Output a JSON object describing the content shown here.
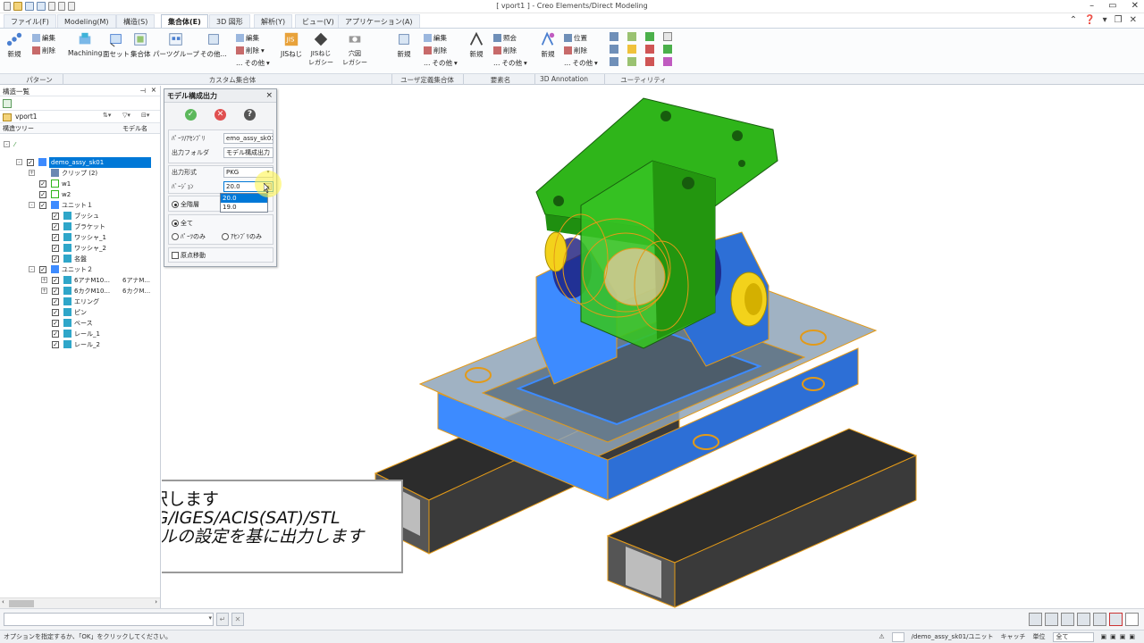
{
  "window": {
    "title": "[ vport1 ] - Creo Elements/Direct Modeling"
  },
  "tabs": [
    {
      "label": "ファイル(F)",
      "active": false
    },
    {
      "label": "Modeling(M)",
      "active": false
    },
    {
      "label": "構造(S)",
      "active": false
    },
    {
      "label": "集合体(E)",
      "active": true
    },
    {
      "label": "3D 図形",
      "active": false
    },
    {
      "label": "解析(Y)",
      "active": false
    },
    {
      "label": "ビュー(V)",
      "active": false
    },
    {
      "label": "アプリケーション(A)",
      "active": false
    }
  ],
  "ribbon": {
    "pattern": {
      "new": "新規",
      "edit": "編集",
      "delete": "削除"
    },
    "custom": {
      "machining": "Machining",
      "faceset": "面セット",
      "assembly_set": "集合体",
      "parts_group": "パーツグループ",
      "other": "その他...",
      "edit": "編集",
      "delete": "削除",
      "other_small": "その他",
      "jis_screw": "JISねじ",
      "jis_screw_legacy": "JISねじ\nレガシー",
      "hole_legacy": "穴図\nレガシー"
    },
    "user_set": {
      "new": "新規",
      "edit": "編集",
      "delete": "削除",
      "other": "その他"
    },
    "element_name": {
      "new": "新規",
      "view": "照会",
      "delete": "削除",
      "other": "その他"
    },
    "annotation": {
      "new": "新規",
      "position": "位置",
      "delete": "削除",
      "other": "その他"
    }
  },
  "ribbon_groups": [
    "パターン",
    "カスタム集合体",
    "ユーザ定義集合体",
    "要素名",
    "3D Annotation",
    "ユーティリティ"
  ],
  "left_panel": {
    "header": "構造一覧",
    "viewport": "vport1",
    "col_tree": "構造ツリー",
    "col_model": "モデル名",
    "tree": [
      {
        "label": "demo_assy_sk01",
        "model": "",
        "indent": 0,
        "selected": true,
        "expand": "-",
        "check": true,
        "icon": "assembly-icon"
      },
      {
        "label": "クリップ (2)",
        "model": "",
        "indent": 1,
        "expand": "+",
        "check": null,
        "icon": "folder-icon"
      },
      {
        "label": "w1",
        "model": "",
        "indent": 1,
        "expand": "",
        "check": true,
        "icon": "workplane-icon"
      },
      {
        "label": "w2",
        "model": "",
        "indent": 1,
        "expand": "",
        "check": true,
        "icon": "workplane-icon"
      },
      {
        "label": "ユニット１",
        "model": "",
        "indent": 1,
        "expand": "-",
        "check": true,
        "icon": "assembly-icon"
      },
      {
        "label": "ブッシュ",
        "model": "",
        "indent": 2,
        "expand": "",
        "check": true,
        "icon": "part-icon"
      },
      {
        "label": "ブラケット",
        "model": "",
        "indent": 2,
        "expand": "",
        "check": true,
        "icon": "part-icon"
      },
      {
        "label": "ワッシャ_1",
        "model": "",
        "indent": 2,
        "expand": "",
        "check": true,
        "icon": "part-icon"
      },
      {
        "label": "ワッシャ_2",
        "model": "",
        "indent": 2,
        "expand": "",
        "check": true,
        "icon": "part-icon"
      },
      {
        "label": "名盤",
        "model": "",
        "indent": 2,
        "expand": "",
        "check": true,
        "icon": "part-icon"
      },
      {
        "label": "ユニット２",
        "model": "",
        "indent": 1,
        "expand": "-",
        "check": true,
        "icon": "assembly-icon"
      },
      {
        "label": "6アナM10...",
        "model": "6アナM...",
        "indent": 2,
        "expand": "+",
        "check": true,
        "icon": "part-icon"
      },
      {
        "label": "6カクM10...",
        "model": "6カクM...",
        "indent": 2,
        "expand": "+",
        "check": true,
        "icon": "part-icon"
      },
      {
        "label": "エリング",
        "model": "",
        "indent": 2,
        "expand": "",
        "check": true,
        "icon": "part-icon"
      },
      {
        "label": "ピン",
        "model": "",
        "indent": 2,
        "expand": "",
        "check": true,
        "icon": "part-icon"
      },
      {
        "label": "ベース",
        "model": "",
        "indent": 2,
        "expand": "",
        "check": true,
        "icon": "part-icon"
      },
      {
        "label": "レール_1",
        "model": "",
        "indent": 2,
        "expand": "",
        "check": true,
        "icon": "part-icon"
      },
      {
        "label": "レール_2",
        "model": "",
        "indent": 2,
        "expand": "",
        "check": true,
        "icon": "part-icon"
      }
    ]
  },
  "dialog": {
    "title": "モデル構成出力",
    "fields": {
      "part_label": "ﾊﾟｰﾂ/ｱｾﾝﾌﾞﾘ",
      "part_value": "emo_assy_sk01",
      "folder_label": "出力フォルダ",
      "folder_value": "モデル構成出力",
      "format_label": "出力形式",
      "format_value": "PKG",
      "version_label": "ﾊﾞｰｼﾞｮﾝ",
      "version_value": "20.0"
    },
    "version_options": [
      "20.0",
      "19.0"
    ],
    "level_all": "全階層",
    "all": "全て",
    "parts_only": "ﾊﾟｰﾂのみ",
    "asm_only": "ｱｾﾝﾌﾞﾘのみ",
    "origin_move": "原点移動"
  },
  "caption": {
    "line1": "出力形式を選択します",
    "line2": "対応形式：PKG/IGES/ACIS(SAT)/STL",
    "line3": "※SCFGファイルの設定を基に出力します"
  },
  "statusbar": {
    "message": "オプションを指定するか、「OK」をクリックしてください。",
    "path": "/demo_assy_sk01/ユニット",
    "catch": "キャッチ",
    "unit": "単位",
    "all": "全て"
  },
  "colors": {
    "accent": "#0078d7",
    "green_part": "#2fb51a",
    "blue_part": "#3d8bff",
    "yellow_part": "#f3d21b",
    "orange_edges": "#e39a18",
    "rail": "#2b2b2b"
  }
}
